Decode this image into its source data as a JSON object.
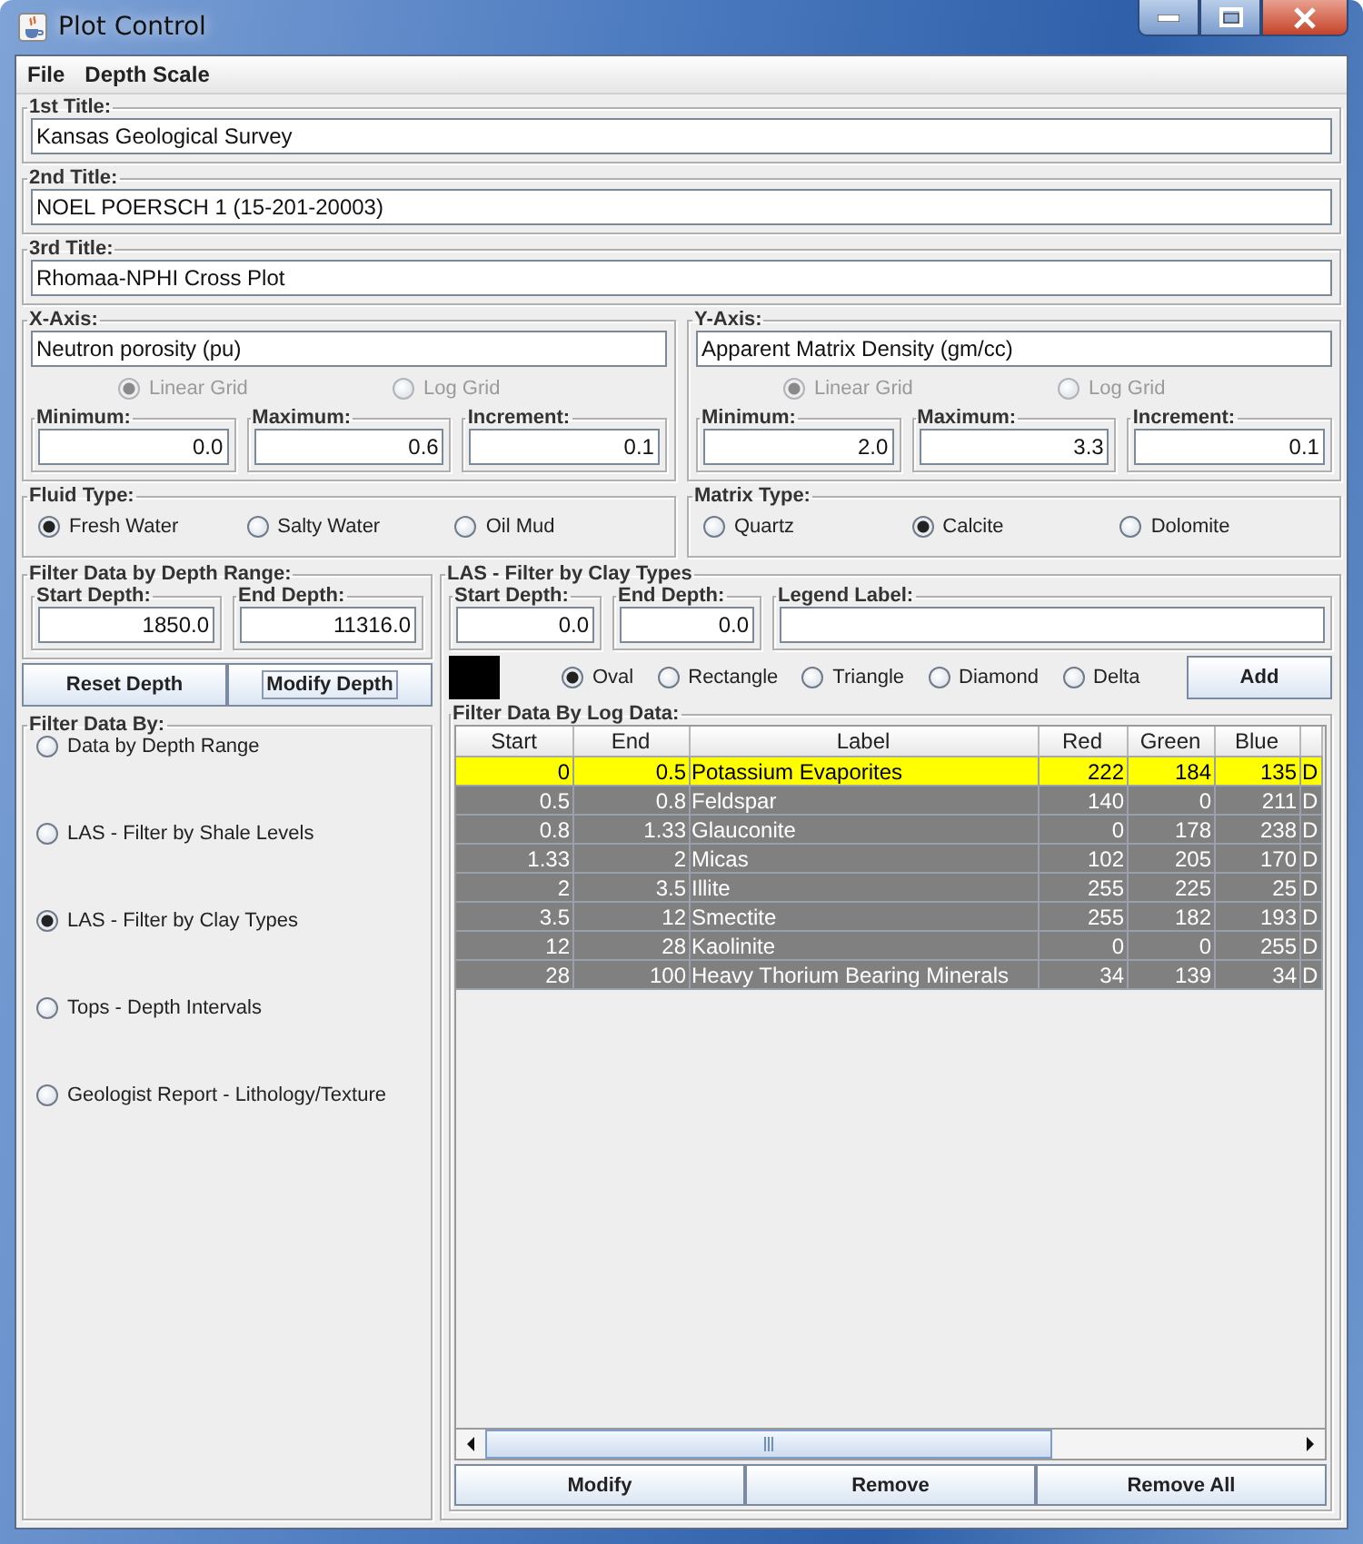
{
  "window": {
    "title": "Plot Control"
  },
  "menu": [
    "File",
    "Depth Scale"
  ],
  "titles": [
    {
      "label": "1st Title:",
      "value": "Kansas Geological Survey"
    },
    {
      "label": "2nd Title:",
      "value": "NOEL POERSCH 1 (15-201-20003)"
    },
    {
      "label": "3rd Title:",
      "value": "Rhomaa-NPHI Cross Plot"
    }
  ],
  "axes": [
    {
      "label": "X-Axis:",
      "value": "Neutron porosity (pu)",
      "grid_options": [
        {
          "label": "Linear Grid",
          "selected": true,
          "disabled": true
        },
        {
          "label": "Log Grid",
          "selected": false,
          "disabled": true
        }
      ],
      "limits": [
        {
          "label": "Minimum:",
          "value": "0.0"
        },
        {
          "label": "Maximum:",
          "value": "0.6"
        },
        {
          "label": "Increment:",
          "value": "0.1"
        }
      ]
    },
    {
      "label": "Y-Axis:",
      "value": "Apparent Matrix Density (gm/cc)",
      "grid_options": [
        {
          "label": "Linear Grid",
          "selected": true,
          "disabled": true
        },
        {
          "label": "Log Grid",
          "selected": false,
          "disabled": true
        }
      ],
      "limits": [
        {
          "label": "Minimum:",
          "value": "2.0"
        },
        {
          "label": "Maximum:",
          "value": "3.3"
        },
        {
          "label": "Increment:",
          "value": "0.1"
        }
      ]
    }
  ],
  "fluid_type": {
    "label": "Fluid Type:",
    "options": [
      {
        "label": "Fresh Water",
        "selected": true
      },
      {
        "label": "Salty Water",
        "selected": false
      },
      {
        "label": "Oil Mud",
        "selected": false
      }
    ]
  },
  "matrix_type": {
    "label": "Matrix Type:",
    "options": [
      {
        "label": "Quartz",
        "selected": false
      },
      {
        "label": "Calcite",
        "selected": true
      },
      {
        "label": "Dolomite",
        "selected": false
      }
    ]
  },
  "depth_range": {
    "label": "Filter Data by Depth Range:",
    "fields": [
      {
        "label": "Start Depth:",
        "value": "1850.0"
      },
      {
        "label": "End Depth:",
        "value": "11316.0"
      }
    ],
    "buttons": [
      {
        "label": "Reset Depth",
        "focused": false
      },
      {
        "label": "Modify Depth",
        "focused": true
      }
    ]
  },
  "filter_by": {
    "label": "Filter Data By:",
    "options": [
      {
        "label": "Data by Depth Range",
        "selected": false
      },
      {
        "label": "LAS - Filter by Shale Levels",
        "selected": false
      },
      {
        "label": "LAS - Filter by Clay Types",
        "selected": true
      },
      {
        "label": "Tops - Depth Intervals",
        "selected": false
      },
      {
        "label": "Geologist Report - Lithology/Texture",
        "selected": false
      }
    ]
  },
  "clay_filter": {
    "label": "LAS - Filter by Clay Types",
    "fields": [
      {
        "label": "Start Depth:",
        "value": "0.0"
      },
      {
        "label": "End Depth:",
        "value": "0.0"
      },
      {
        "label": "Legend Label:"
      }
    ],
    "symbols": [
      {
        "label": "Oval",
        "selected": true
      },
      {
        "label": "Rectangle",
        "selected": false
      },
      {
        "label": "Triangle",
        "selected": false
      },
      {
        "label": "Diamond",
        "selected": false
      },
      {
        "label": "Delta",
        "selected": false
      }
    ],
    "add_button": "Add",
    "log_data": {
      "label": "Filter Data By Log Data:",
      "columns": [
        "Start",
        "End",
        "Label",
        "Red",
        "Green",
        "Blue"
      ],
      "rows": [
        {
          "cells": [
            "0",
            "0.5",
            "Potassium Evaporites",
            "222",
            "184",
            "135",
            "D"
          ],
          "selected": true
        },
        {
          "cells": [
            "0.5",
            "0.8",
            "Feldspar",
            "140",
            "0",
            "211",
            "D"
          ],
          "selected": false
        },
        {
          "cells": [
            "0.8",
            "1.33",
            "Glauconite",
            "0",
            "178",
            "238",
            "D"
          ],
          "selected": false
        },
        {
          "cells": [
            "1.33",
            "2",
            "Micas",
            "102",
            "205",
            "170",
            "D"
          ],
          "selected": false
        },
        {
          "cells": [
            "2",
            "3.5",
            "Illite",
            "255",
            "225",
            "25",
            "D"
          ],
          "selected": false
        },
        {
          "cells": [
            "3.5",
            "12",
            "Smectite",
            "255",
            "182",
            "193",
            "D"
          ],
          "selected": false
        },
        {
          "cells": [
            "12",
            "28",
            "Kaolinite",
            "0",
            "0",
            "255",
            "D"
          ],
          "selected": false
        },
        {
          "cells": [
            "28",
            "100",
            "Heavy Thorium Bearing Minerals",
            "34",
            "139",
            "34",
            "D"
          ],
          "selected": false
        }
      ],
      "buttons": [
        "Modify",
        "Remove",
        "Remove All"
      ]
    }
  }
}
